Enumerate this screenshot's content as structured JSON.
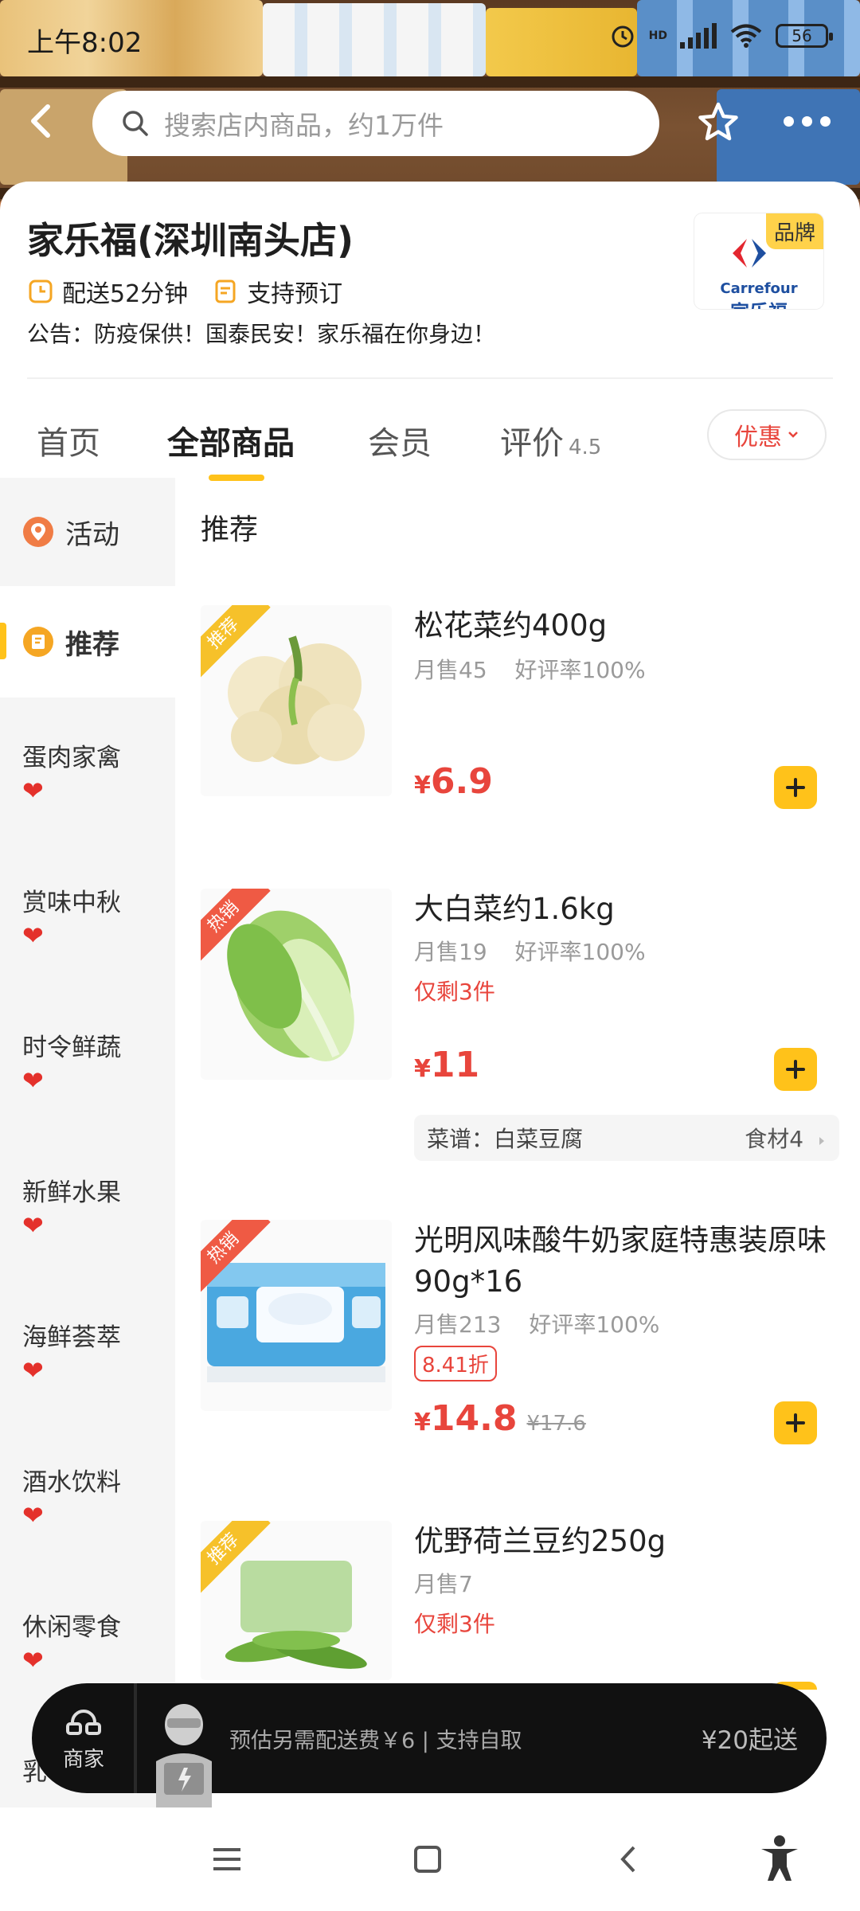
{
  "status_bar": {
    "time": "上午8:02",
    "hd_label": "HD",
    "battery": "56"
  },
  "search": {
    "placeholder": "搜索店内商品，约1万件"
  },
  "store": {
    "name": "家乐福(深圳南头店)",
    "delivery_time": "配送52分钟",
    "preorder": "支持预订",
    "notice": "公告：防疫保供！国泰民安！家乐福在你身边！",
    "logo": {
      "brand_tag": "品牌",
      "en": "Carrefour",
      "cn": "家乐福"
    }
  },
  "tabs": [
    {
      "label": "首页"
    },
    {
      "label": "全部商品"
    },
    {
      "label": "会员"
    },
    {
      "label": "评价",
      "rating": "4.5"
    }
  ],
  "promo_button": "优惠",
  "sidebar": {
    "activity": "活动",
    "recommend": "推荐",
    "categories": [
      "蛋肉家禽",
      "赏味中秋",
      "时令鲜蔬",
      "新鲜水果",
      "海鲜荟萃",
      "酒水饮料",
      "休闲零食",
      "乳"
    ]
  },
  "list_title": "推荐",
  "products": [
    {
      "tag": "推荐",
      "name": "松花菜约400g",
      "monthly_sales": "月售45",
      "rating": "好评率100%",
      "price_symbol": "¥",
      "price": "6.9"
    },
    {
      "tag": "热销",
      "name": "大白菜约1.6kg",
      "monthly_sales": "月售19",
      "rating": "好评率100%",
      "stock": "仅剩3件",
      "price_symbol": "¥",
      "price": "11",
      "recipe": {
        "label": "菜谱：白菜豆腐",
        "ingredients": "食材4"
      }
    },
    {
      "tag": "热销",
      "name": "光明风味酸牛奶家庭特惠装原味90g*16",
      "monthly_sales": "月售213",
      "rating": "好评率100%",
      "discount": "8.41折",
      "price_symbol": "¥",
      "price": "14.8",
      "original_price": "¥17.6"
    },
    {
      "tag": "推荐",
      "name": "优野荷兰豆约250g",
      "monthly_sales": "月售7",
      "stock": "仅剩3件"
    }
  ],
  "cart": {
    "merchant_label": "商家",
    "fee_text": "预估另需配送费￥6 | 支持自取",
    "min_order": "¥20起送"
  },
  "colors": {
    "accent": "#ffc21a",
    "price": "#e8453c",
    "cart_bg": "#111111"
  }
}
